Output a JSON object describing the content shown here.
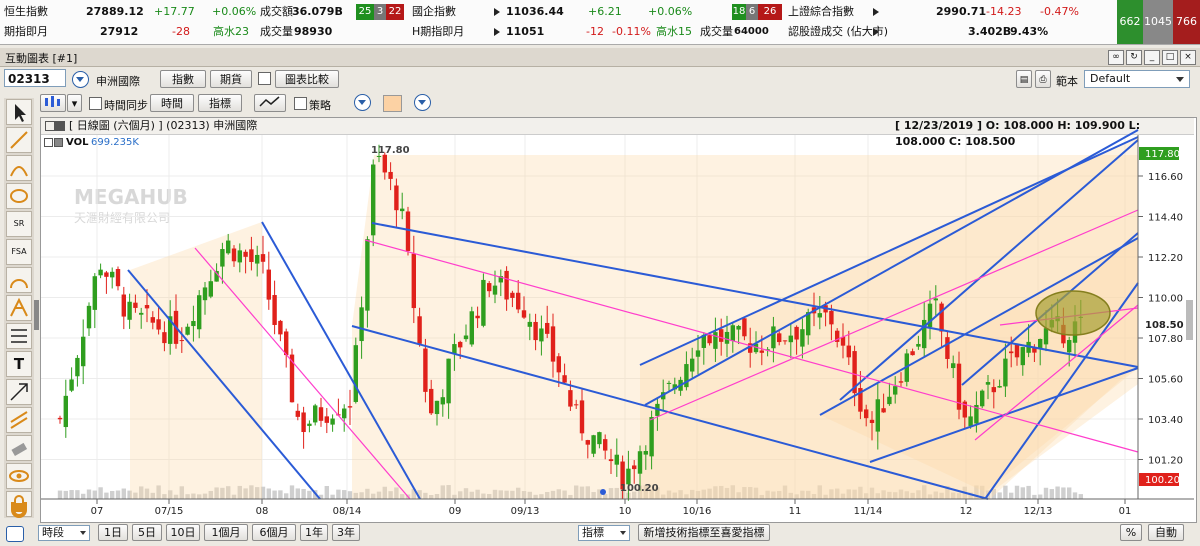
{
  "ticker": {
    "row1": [
      {
        "label": "恒生指數",
        "value": "27889.12",
        "change": "+17.77",
        "pct": "+0.06%",
        "vol_label": "成交額",
        "vol": "36.079B"
      },
      {
        "label": "國企指數",
        "value": "11036.44",
        "change": "+6.21",
        "pct": "+0.06%"
      },
      {
        "label": "上證綜合指數",
        "value": "2990.71",
        "change": "-14.23",
        "pct": "-0.47%"
      }
    ],
    "row2": [
      {
        "label": "期指即月",
        "value": "27912",
        "change": "-28",
        "prem": "高水23",
        "vol_label": "成交量",
        "vol": "98930"
      },
      {
        "label": "H期指即月",
        "value": "11051",
        "change": "-12",
        "pct": "-0.11%",
        "prem": "高水15",
        "vol_label": "成交量",
        "vol": "64000"
      },
      {
        "label": "認股證成交 (佔大市)",
        "value": "3.402B",
        "pct": "9.43%"
      }
    ],
    "breadth_hsi": [
      "25",
      "3",
      "22"
    ],
    "breadth_hscei": [
      "18",
      "6",
      "26"
    ],
    "market_breadth": [
      "662",
      "1045",
      "766"
    ]
  },
  "window": {
    "title": "互動圖表 [#1]"
  },
  "toolbar": {
    "stock_code": "02313",
    "stock_name": "申洲國際",
    "btn_index": "指數",
    "btn_futures": "期貨",
    "btn_compare": "圖表比較",
    "template_label": "範本",
    "template_value": "Default",
    "time_sync": "時間同步",
    "btn_time": "時間",
    "btn_indicator": "指標",
    "strategy": "策略"
  },
  "chart": {
    "header_left": "[ 日線圖 (六個月) ] (02313) 申洲國際",
    "header_right": "[ 12/23/2019 ]  O: 108.000  H: 109.900  L: 108.000  C: 108.500",
    "vol_label": "VOL",
    "vol_value": "699.235K",
    "watermark_en": "MEGAHUB",
    "watermark_zh": "天滙財經有限公司",
    "high_label": "117.80",
    "low_label": "100.20",
    "last_label": "108.50",
    "x_labels": [
      "07",
      "07/15",
      "08",
      "08/14",
      "09",
      "09/13",
      "10",
      "10/16",
      "11",
      "11/14",
      "12",
      "12/13",
      "01"
    ],
    "y_labels": [
      "116.60",
      "114.40",
      "112.20",
      "110.00",
      "107.80",
      "105.60",
      "103.40",
      "101.20"
    ],
    "colors": {
      "up": "#2f9e1f",
      "down": "#e0211b",
      "trend": "#2b5bd6",
      "pitch": "#ff3dcc",
      "fill": "#fcd9a8"
    }
  },
  "bottom": {
    "period": "時段",
    "btn_1d": "1日",
    "btn_5d": "5日",
    "btn_10d": "10日",
    "btn_1m": "1個月",
    "btn_6m": "6個月",
    "btn_1y": "1年",
    "btn_3y": "3年",
    "indicator_select": "指標",
    "add_indicator": "新增技術指標至喜愛指標",
    "pct": "%",
    "auto": "自動"
  }
}
